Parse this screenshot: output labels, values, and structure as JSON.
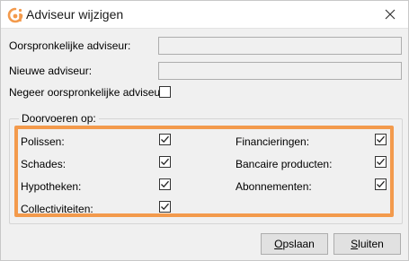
{
  "window": {
    "title": "Adviseur wijzigen"
  },
  "icons": {
    "app": "logo-icon",
    "close": "close-icon",
    "check": "checkmark-icon"
  },
  "colors": {
    "accent": "#f39a4c",
    "brand": "#f39a4c"
  },
  "fields": {
    "original_label": "Oorspronkelijke adviseur:",
    "original_value": "",
    "new_label": "Nieuwe adviseur:",
    "new_value": "",
    "ignore_label": "Negeer oorspronkelijke adviseur:",
    "ignore_checked": false
  },
  "group": {
    "title": "Doorvoeren op:",
    "options": [
      {
        "label": "Polissen:",
        "checked": true
      },
      {
        "label": "Schades:",
        "checked": true
      },
      {
        "label": "Hypotheken:",
        "checked": true
      },
      {
        "label": "Collectiviteiten:",
        "checked": true
      },
      {
        "label": "Financieringen:",
        "checked": true
      },
      {
        "label": "Bancaire producten:",
        "checked": true
      },
      {
        "label": "Abonnementen:",
        "checked": true
      }
    ]
  },
  "buttons": {
    "save_accel": "O",
    "save_rest": "pslaan",
    "close_accel": "S",
    "close_rest": "luiten"
  }
}
